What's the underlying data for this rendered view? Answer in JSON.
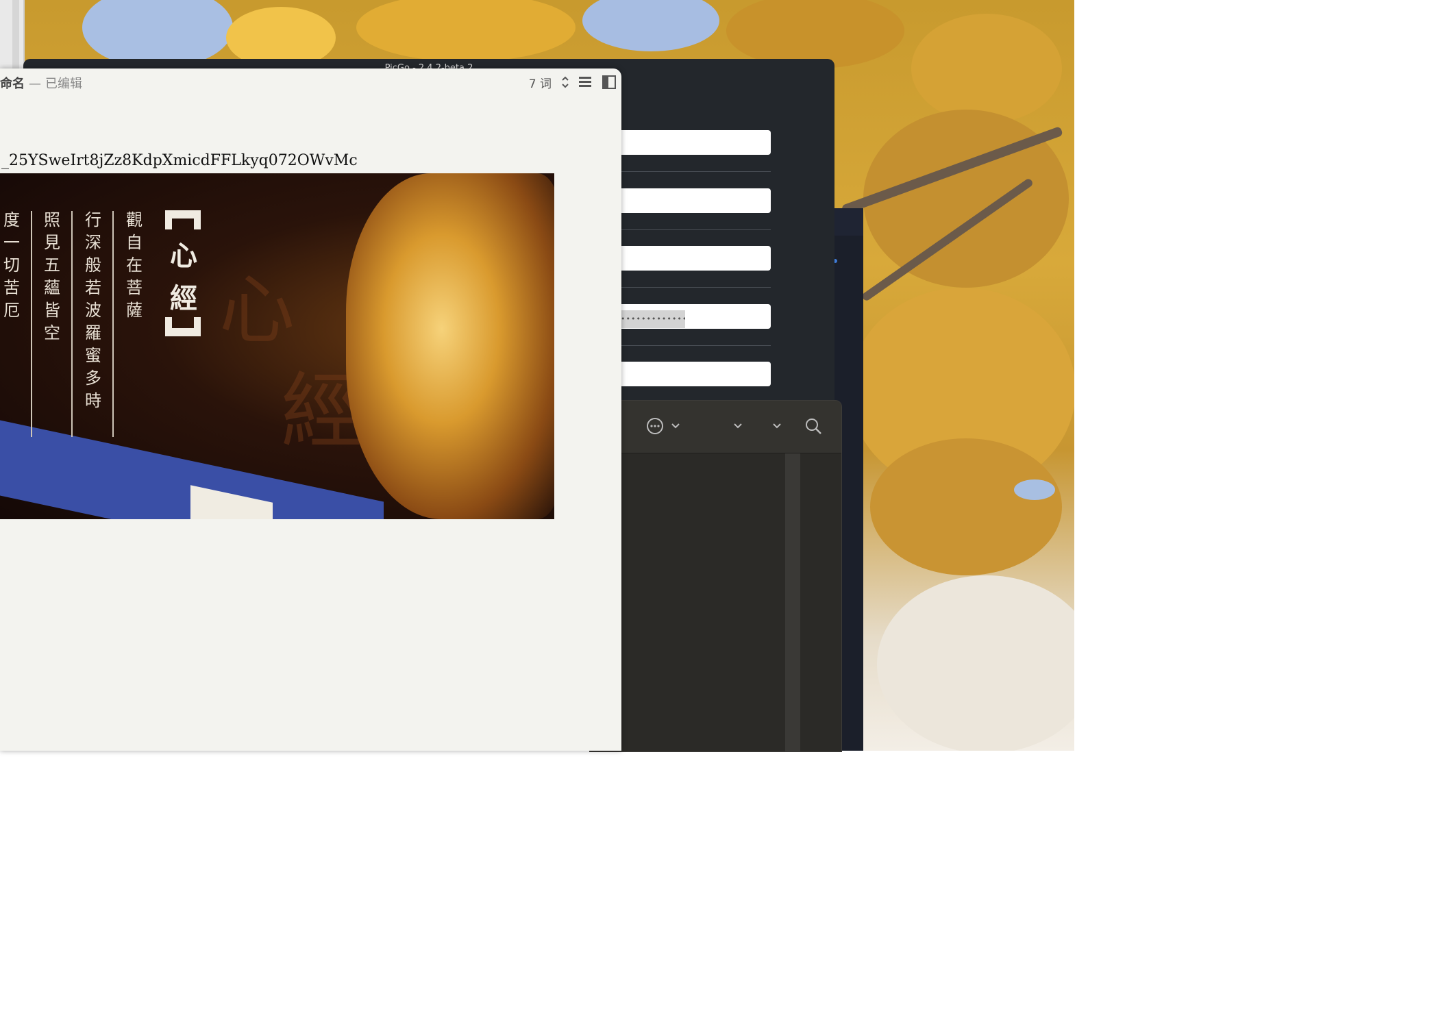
{
  "picgo": {
    "title": "PicGo - 2.4.2-beta.2",
    "password_mask": "••••••••••••••••"
  },
  "editor": {
    "title_name": "命名",
    "title_separator": "—",
    "title_status": "已编辑",
    "word_count": "7 词",
    "word_count_stepper": "⌃",
    "doc_text": "_25YSweIrt8jZz8KdpXmicdFFLkyq072OWvMc"
  },
  "art": {
    "columns": [
      {
        "text": "觀自在菩薩"
      },
      {
        "text": "行深般若波羅蜜多時"
      },
      {
        "text": "照見五蘊皆空"
      },
      {
        "text": "度一切苦厄"
      }
    ],
    "heading": "心經",
    "big_xin": "心",
    "big_jing": "經"
  },
  "finder": {
    "icons": [
      "more-icon",
      "chevron-down-icon",
      "chevron-down-icon",
      "chevron-down-icon",
      "search-icon"
    ]
  }
}
